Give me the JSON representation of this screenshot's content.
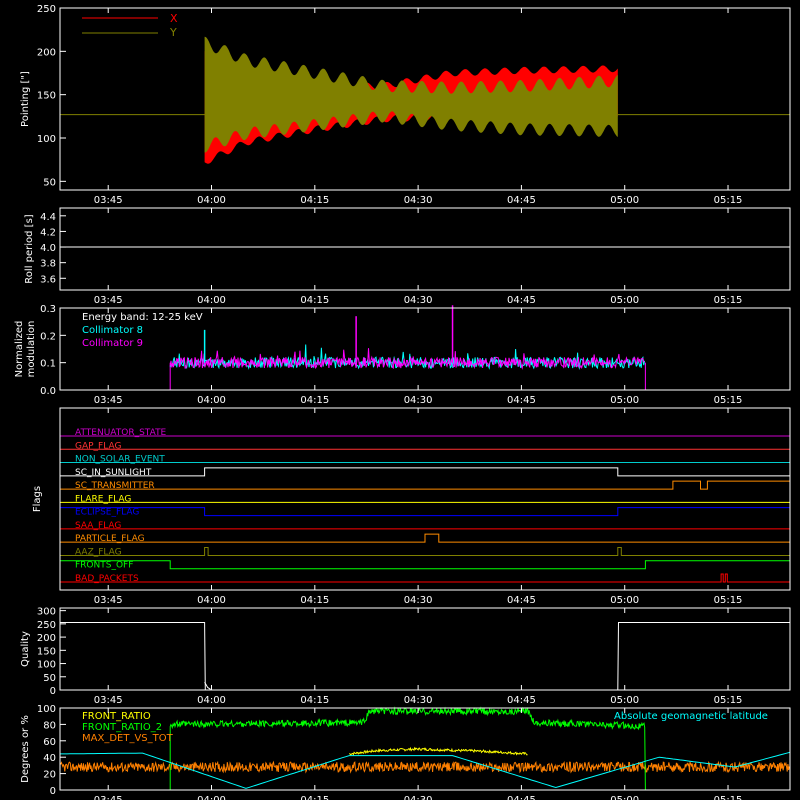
{
  "time_axis": {
    "range": [
      "03:38",
      "05:24"
    ],
    "ticks": [
      "03:45",
      "04:00",
      "04:15",
      "04:30",
      "04:45",
      "05:00",
      "05:15"
    ]
  },
  "colors": {
    "background": "#000000",
    "axes": "#ffffff",
    "x_pointing": "#ff0000",
    "y_pointing": "#808000",
    "collimator8": "#00ffff",
    "collimator9": "#ff00ff",
    "front_ratio": "#ffff00",
    "front_ratio2": "#00ff00",
    "max_det": "#ff8000",
    "geomag": "#00ffff"
  },
  "chart_data": [
    {
      "id": "pointing",
      "type": "area",
      "ylabel": "Pointing [\"]",
      "ylim": [
        40,
        250
      ],
      "yticks": [
        "50",
        "100",
        "150",
        "200",
        "250"
      ],
      "legend": [
        "X",
        "Y"
      ],
      "legend_position": "top-left",
      "baseline": 127,
      "start": "03:59",
      "end": "04:59",
      "series": [
        {
          "name": "X",
          "x": [
            "03:59",
            "04:05",
            "04:15",
            "04:25",
            "04:35",
            "04:45",
            "04:59"
          ],
          "upper": [
            200,
            180,
            160,
            160,
            175,
            178,
            180
          ],
          "lower": [
            72,
            95,
            110,
            122,
            125,
            125,
            125
          ]
        },
        {
          "name": "Y",
          "x": [
            "03:59",
            "04:05",
            "04:15",
            "04:25",
            "04:35",
            "04:45",
            "04:59"
          ],
          "upper": [
            210,
            190,
            175,
            160,
            158,
            160,
            166
          ],
          "lower": [
            90,
            105,
            115,
            125,
            115,
            110,
            108
          ]
        }
      ]
    },
    {
      "id": "roll",
      "type": "line",
      "ylabel": "Roll period [s]",
      "ylim": [
        3.45,
        4.5
      ],
      "yticks": [
        "3.6",
        "3.8",
        "4.0",
        "4.2",
        "4.4"
      ],
      "series": [
        {
          "x": [
            "03:38",
            "05:24"
          ],
          "values": [
            4.0,
            4.0
          ]
        }
      ]
    },
    {
      "id": "modulation",
      "type": "line",
      "ylabel": "Normalized modulation",
      "ylim": [
        0,
        0.3
      ],
      "yticks": [
        "0.0",
        "0.1",
        "0.2",
        "0.3"
      ],
      "annotations": [
        "Energy band: 12-25 keV"
      ],
      "legend": [
        "Collimator 8",
        "Collimator 9"
      ],
      "start": "03:54",
      "end": "05:03",
      "level": 0.1,
      "spikes": [
        {
          "x": "04:21",
          "value": 0.27,
          "series": "Collimator 9"
        },
        {
          "x": "04:35",
          "value": 0.31,
          "series": "Collimator 9"
        },
        {
          "x": "03:59",
          "value": 0.22,
          "series": "Collimator 8"
        }
      ]
    },
    {
      "id": "flags",
      "type": "line",
      "ylabel": "Flags",
      "flags": [
        {
          "name": "ATTENUATOR_STATE",
          "color": "#cc00cc",
          "high": []
        },
        {
          "name": "GAP_FLAG",
          "color": "#ff3333",
          "high": []
        },
        {
          "name": "NON_SOLAR_EVENT",
          "color": "#00cccc",
          "high": []
        },
        {
          "name": "SC_IN_SUNLIGHT",
          "color": "#ffffff",
          "high": [
            [
              "03:59",
              "04:59"
            ]
          ]
        },
        {
          "name": "SC_TRANSMITTER",
          "color": "#ff8c00",
          "high": [
            [
              "05:07",
              "05:11"
            ],
            [
              "05:12",
              "05:24"
            ]
          ]
        },
        {
          "name": "FLARE_FLAG",
          "color": "#ffff00",
          "high": []
        },
        {
          "name": "ECLIPSE_FLAG",
          "color": "#0000ff",
          "high": [
            [
              "03:38",
              "03:59"
            ],
            [
              "04:59",
              "05:24"
            ]
          ]
        },
        {
          "name": "SAA_FLAG",
          "color": "#ff0000",
          "high": []
        },
        {
          "name": "PARTICLE_FLAG",
          "color": "#ff8c00",
          "high": [
            [
              "04:31",
              "04:33"
            ]
          ]
        },
        {
          "name": "AAZ_FLAG",
          "color": "#808000",
          "high": [
            [
              "03:59",
              "03:59.5"
            ],
            [
              "04:59",
              "04:59.5"
            ]
          ]
        },
        {
          "name": "FRONTS_OFF",
          "color": "#00ff00",
          "high": [
            [
              "03:38",
              "03:54"
            ],
            [
              "05:03",
              "05:24"
            ]
          ]
        },
        {
          "name": "BAD_PACKETS",
          "color": "#ff0000",
          "high": [
            [
              "05:14",
              "05:14.3"
            ],
            [
              "05:14.6",
              "05:14.9"
            ]
          ]
        }
      ]
    },
    {
      "id": "quality",
      "type": "line",
      "ylabel": "Quality",
      "ylim": [
        0,
        310
      ],
      "yticks": [
        "0",
        "50",
        "100",
        "150",
        "200",
        "250",
        "300"
      ],
      "series": [
        {
          "x": [
            "03:38",
            "03:59",
            "03:59.1",
            "04:59",
            "04:59.1",
            "05:24"
          ],
          "values": [
            255,
            255,
            0,
            0,
            255,
            255
          ]
        }
      ]
    },
    {
      "id": "ratios",
      "type": "line",
      "ylabel": "Degrees or %",
      "ylim": [
        0,
        100
      ],
      "yticks": [
        "0",
        "20",
        "40",
        "60",
        "80",
        "100"
      ],
      "legend": [
        "FRONT_RATIO",
        "FRONT_RATIO_2",
        "MAX_DET_VS_TOT",
        "Absolute geomagnetic latitude"
      ],
      "series": [
        {
          "name": "FRONT_RATIO",
          "x": [
            "04:20",
            "04:24",
            "04:30",
            "04:40",
            "04:46"
          ],
          "values": [
            44,
            48,
            50,
            47,
            44
          ]
        },
        {
          "name": "FRONT_RATIO_2",
          "x": [
            "03:54",
            "04:22",
            "04:23",
            "04:46",
            "04:47",
            "05:03"
          ],
          "values": [
            80,
            82,
            96,
            96,
            82,
            78
          ]
        },
        {
          "name": "MAX_DET_VS_TOT",
          "x": [
            "03:38",
            "05:24"
          ],
          "values": [
            28,
            28
          ]
        },
        {
          "name": "Absolute geomagnetic latitude",
          "x": [
            "03:38",
            "03:50",
            "04:05",
            "04:20",
            "04:35",
            "04:50",
            "05:05",
            "05:16",
            "05:24"
          ],
          "values": [
            44,
            45,
            2,
            42,
            42,
            3,
            40,
            28,
            46
          ]
        }
      ]
    }
  ]
}
